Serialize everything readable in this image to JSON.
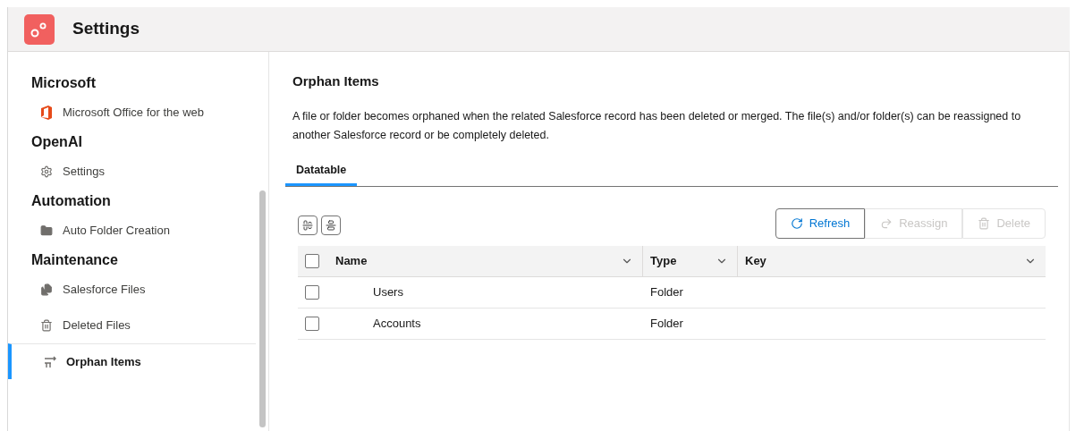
{
  "header": {
    "title": "Settings"
  },
  "sidebar": {
    "groups": [
      {
        "heading": "Microsoft",
        "items": [
          {
            "label": "Microsoft Office for the web",
            "kind": "office",
            "selected": false
          }
        ]
      },
      {
        "heading": "OpenAI",
        "items": [
          {
            "label": "Settings",
            "kind": "gear",
            "selected": false
          }
        ]
      },
      {
        "heading": "Automation",
        "items": [
          {
            "label": "Auto Folder Creation",
            "kind": "folder",
            "selected": false
          }
        ]
      },
      {
        "heading": "Maintenance",
        "items": [
          {
            "label": "Salesforce Files",
            "kind": "files",
            "selected": false
          },
          {
            "label": "Deleted Files",
            "kind": "trash",
            "selected": false
          },
          {
            "label": "Orphan Items",
            "kind": "orphan",
            "selected": true
          }
        ]
      }
    ]
  },
  "content": {
    "title": "Orphan Items",
    "description": "A file or folder becomes orphaned when the related Salesforce record has been deleted or merged. The file(s) and/or folder(s) can be reassigned to another Salesforce record or be completely deleted.",
    "tabs": [
      {
        "label": "Datatable",
        "selected": true
      }
    ],
    "actions": [
      {
        "label": "Refresh",
        "kind": "refresh",
        "disabled": false
      },
      {
        "label": "Reassign",
        "kind": "reassign",
        "disabled": true
      },
      {
        "label": "Delete",
        "kind": "trash",
        "disabled": true
      }
    ],
    "table": {
      "select_all_checked": false,
      "columns": [
        "Name",
        "Type",
        "Key"
      ],
      "rows": [
        {
          "name": "Users",
          "type": "Folder",
          "checked": false
        },
        {
          "name": "Accounts",
          "type": "Folder",
          "checked": false
        }
      ]
    }
  }
}
